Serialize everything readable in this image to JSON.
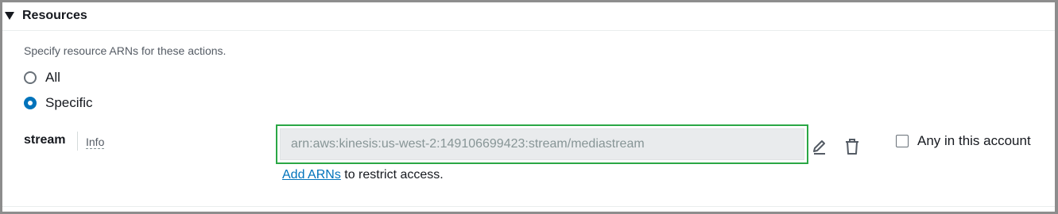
{
  "section": {
    "title": "Resources",
    "caret_icon": "caret-down-icon",
    "description": "Specify resource ARNs for these actions."
  },
  "scope": {
    "options": [
      {
        "label": "All",
        "selected": false
      },
      {
        "label": "Specific",
        "selected": true
      }
    ]
  },
  "resource": {
    "type_label": "stream",
    "info_label": "Info",
    "arn_value": "arn:aws:kinesis:us-west-2:149106699423:stream/mediastream",
    "edit_icon": "pencil-icon",
    "delete_icon": "trash-icon",
    "any_in_account_label": "Any in this account",
    "any_in_account_checked": false,
    "add_link_label": "Add ARNs",
    "helper_suffix": " to restrict access."
  },
  "colors": {
    "accent": "#0073bb",
    "highlight": "#2aa745",
    "muted": "#879596"
  }
}
